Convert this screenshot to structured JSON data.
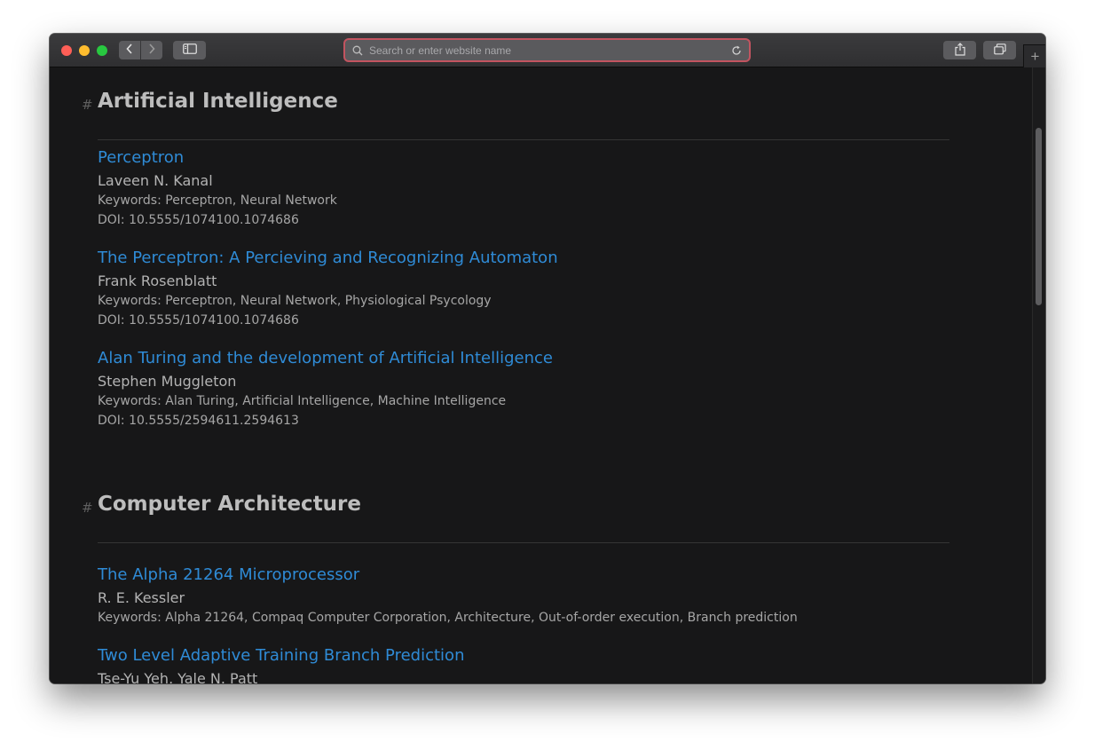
{
  "toolbar": {
    "address_placeholder": "Search or enter website name",
    "back_glyph": "‹",
    "forward_glyph": "›",
    "new_tab_glyph": "+"
  },
  "sections": [
    {
      "hash": "#",
      "title": "Artificial Intelligence",
      "entries": [
        {
          "title": "Perceptron",
          "author": "Laveen N. Kanal",
          "keywords": "Keywords: Perceptron, Neural Network",
          "doi": "DOI: 10.5555/1074100.1074686"
        },
        {
          "title": "The Perceptron: A Percieving and Recognizing Automaton",
          "author": "Frank Rosenblatt",
          "keywords": "Keywords: Perceptron, Neural Network, Physiological Psycology",
          "doi": "DOI: 10.5555/1074100.1074686"
        },
        {
          "title": "Alan Turing and the development of Artificial Intelligence",
          "author": "Stephen Muggleton",
          "keywords": "Keywords: Alan Turing, Artificial Intelligence, Machine Intelligence",
          "doi": "DOI: 10.5555/2594611.2594613"
        }
      ]
    },
    {
      "hash": "#",
      "title": "Computer Architecture",
      "entries": [
        {
          "title": "The Alpha 21264 Microprocessor",
          "author": "R. E. Kessler",
          "keywords": "Keywords: Alpha 21264, Compaq Computer Corporation, Architecture, Out-of-order execution, Branch prediction"
        },
        {
          "title": "Two Level Adaptive Training Branch Prediction",
          "author": "Tse-Yu Yeh, Yale N. Patt"
        }
      ]
    }
  ]
}
